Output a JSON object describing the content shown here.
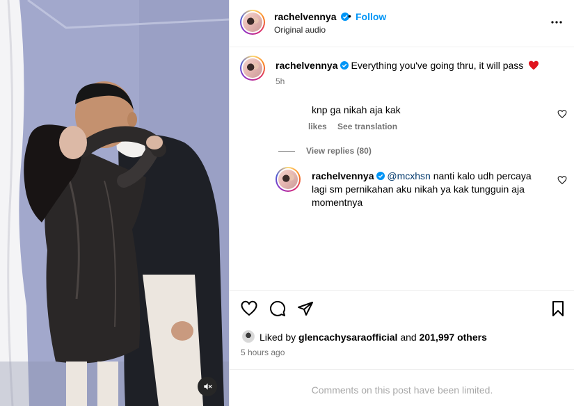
{
  "header": {
    "username": "rachelvennya",
    "separator": "•",
    "follow_label": "Follow",
    "audio_label": "Original audio",
    "more_icon": "more-horizontal-icon"
  },
  "caption": {
    "username": "rachelvennya",
    "text": "Everything you've going thru, it will pass",
    "emoji": "❤️",
    "time": "5h"
  },
  "comments": [
    {
      "text": "knp ga nikah aja kak",
      "likes_label": "likes",
      "translate_label": "See translation",
      "view_replies_label": "View replies (80)"
    }
  ],
  "reply": {
    "username": "rachelvennya",
    "mention": "@mcxhsn",
    "text": "nanti kalo udh percaya lagi sm pernikahan aku nikah ya kak tungguin aja momentnya"
  },
  "likes": {
    "prefix": "Liked by",
    "user": "glencachysaraofficial",
    "middle": "and",
    "others": "201,997 others"
  },
  "time_ago": "5 hours ago",
  "comments_limited": "Comments on this post have been limited.",
  "colors": {
    "accent": "#0095f6",
    "verified": "#0095f6",
    "heart": "#ff3040",
    "muted_text": "#737373"
  }
}
